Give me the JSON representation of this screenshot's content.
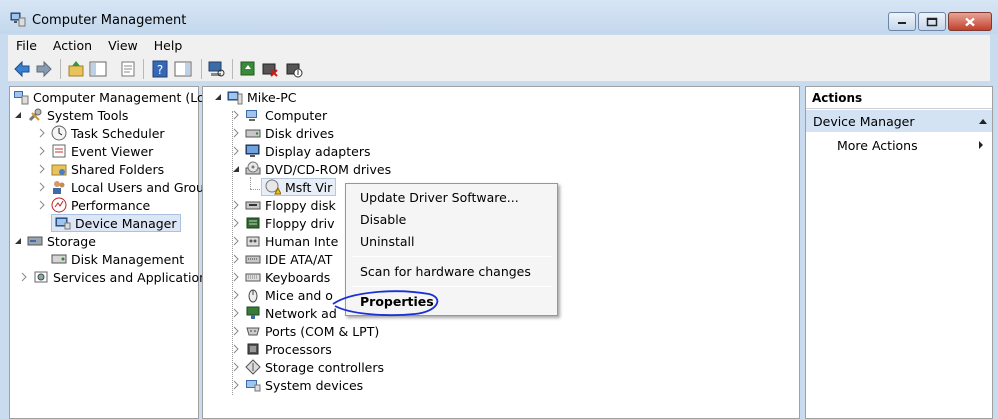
{
  "window": {
    "title": "Computer Management"
  },
  "menu": [
    "File",
    "Action",
    "View",
    "Help"
  ],
  "left_tree": {
    "root": "Computer Management (Local",
    "system_tools": "System Tools",
    "system_tools_items": [
      "Task Scheduler",
      "Event Viewer",
      "Shared Folders",
      "Local Users and Groups",
      "Performance",
      "Device Manager"
    ],
    "storage": "Storage",
    "storage_items": [
      "Disk Management"
    ],
    "services": "Services and Applications"
  },
  "device_tree": {
    "root": "Mike-PC",
    "categories": [
      "Computer",
      "Disk drives",
      "Display adapters",
      "DVD/CD-ROM drives"
    ],
    "dvd_child": "Msft Virtual CD/ROM ATA Device",
    "more_categories": [
      "Floppy disk drives",
      "Floppy drive controllers",
      "Human Interface Devices",
      "IDE ATA/ATAPI controllers",
      "Keyboards",
      "Mice and other pointing devices",
      "Network adapters",
      "Ports (COM & LPT)",
      "Processors",
      "Storage controllers",
      "System devices"
    ],
    "visible_more": [
      "Floppy disk",
      "Floppy driv",
      "Human Inte",
      "IDE ATA/AT",
      "Keyboards",
      "Mice and o",
      "Network ad",
      "Ports (COM & LPT)",
      "Processors",
      "Storage controllers",
      "System devices"
    ],
    "visible_dvd_child": "Msft Vir"
  },
  "context_menu": {
    "items": [
      "Update Driver Software...",
      "Disable",
      "Uninstall",
      "Scan for hardware changes",
      "Properties"
    ]
  },
  "actions": {
    "header": "Actions",
    "section": "Device Manager",
    "more": "More Actions"
  },
  "colors": {
    "annotation": "#1a2fd6",
    "selection": "#dce6f4",
    "window_frame": "#c9dcef"
  }
}
